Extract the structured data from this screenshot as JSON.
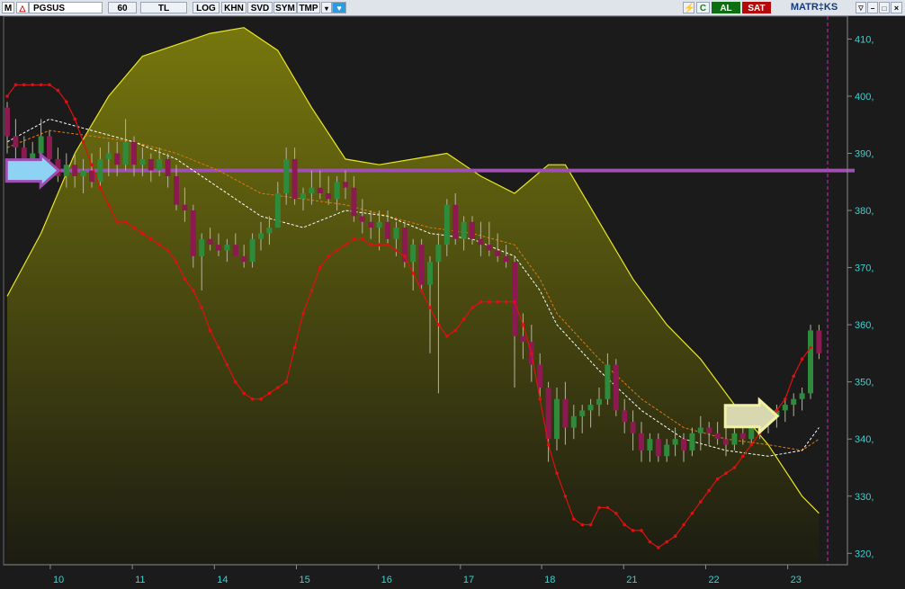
{
  "toolbar": {
    "m_label": "M",
    "logo_label": "△",
    "symbol": "PGSUS",
    "period": "60",
    "currency": "TL",
    "log": "LOG",
    "khn": "KHN",
    "svd": "SVD",
    "sym": "SYM",
    "tmp": "TMP",
    "dropdown": "▾",
    "twitter": "♥",
    "bolt": "⚡",
    "refresh": "C",
    "buy": "AL",
    "sell": "SAT",
    "brand": "MATR‡KS",
    "win_down": "▽",
    "win_min": "−",
    "win_max": "□",
    "win_close": "×"
  },
  "colors": {
    "background": "#1b1b1b",
    "band_fill": "#6c6c0c",
    "band_line": "#e8e820",
    "price_up": "#2e8b3c",
    "price_down": "#8b1a50",
    "ma_orange": "#e07a12",
    "ma_white": "#ffffff",
    "red_line": "#e01010",
    "horizontal_line": "#a050b0",
    "axis_text": "#33d6d6"
  },
  "icons": [
    "twitter-icon",
    "bolt-icon",
    "arrow-right-icon"
  ],
  "chart_data": {
    "type": "candlestick",
    "y_axis": {
      "min": 318,
      "max": 414,
      "ticks": [
        410,
        400,
        390,
        380,
        370,
        360,
        350,
        340,
        330,
        320
      ],
      "tick_suffix": ","
    },
    "x_ticks": [
      {
        "label": "10",
        "i": 5.1
      },
      {
        "label": "11",
        "i": 14.8
      },
      {
        "label": "14",
        "i": 24.5
      },
      {
        "label": "15",
        "i": 34.2
      },
      {
        "label": "16",
        "i": 43.9
      },
      {
        "label": "17",
        "i": 53.6
      },
      {
        "label": "18",
        "i": 63.2
      },
      {
        "label": "21",
        "i": 72.9
      },
      {
        "label": "22",
        "i": 82.6
      },
      {
        "label": "23",
        "i": 92.3
      }
    ],
    "candles": [
      [
        398,
        399,
        390,
        393
      ],
      [
        393,
        396,
        388,
        391
      ],
      [
        391,
        393,
        386,
        388
      ],
      [
        388,
        392,
        386,
        390
      ],
      [
        390,
        396,
        389,
        393
      ],
      [
        393,
        394,
        387,
        389
      ],
      [
        389,
        391,
        385,
        386
      ],
      [
        386,
        390,
        384,
        388
      ],
      [
        388,
        390,
        384,
        386
      ],
      [
        386,
        389,
        383,
        387
      ],
      [
        387,
        390,
        384,
        385
      ],
      [
        385,
        391,
        384,
        389
      ],
      [
        389,
        392,
        386,
        390
      ],
      [
        390,
        392,
        386,
        388
      ],
      [
        388,
        396,
        387,
        392
      ],
      [
        392,
        393,
        386,
        388
      ],
      [
        388,
        391,
        386,
        389
      ],
      [
        389,
        390,
        385,
        387
      ],
      [
        387,
        391,
        386,
        389
      ],
      [
        389,
        390,
        384,
        386
      ],
      [
        386,
        388,
        380,
        381
      ],
      [
        381,
        384,
        378,
        380
      ],
      [
        380,
        381,
        370,
        372
      ],
      [
        372,
        376,
        366,
        375
      ],
      [
        375,
        377,
        373,
        374
      ],
      [
        374,
        376,
        372,
        373
      ],
      [
        373,
        375,
        371,
        374
      ],
      [
        374,
        376,
        372,
        372
      ],
      [
        372,
        374,
        370,
        371
      ],
      [
        371,
        376,
        370,
        375
      ],
      [
        375,
        378,
        373,
        376
      ],
      [
        376,
        379,
        374,
        377
      ],
      [
        377,
        385,
        377,
        383
      ],
      [
        383,
        391,
        381,
        389
      ],
      [
        389,
        391,
        381,
        382
      ],
      [
        382,
        384,
        380,
        383
      ],
      [
        383,
        387,
        381,
        384
      ],
      [
        384,
        387,
        382,
        383
      ],
      [
        383,
        386,
        381,
        382
      ],
      [
        382,
        386,
        380,
        385
      ],
      [
        385,
        387,
        382,
        384
      ],
      [
        384,
        386,
        378,
        379
      ],
      [
        379,
        382,
        376,
        378
      ],
      [
        378,
        380,
        375,
        377
      ],
      [
        377,
        380,
        373,
        378
      ],
      [
        378,
        380,
        374,
        375
      ],
      [
        375,
        378,
        372,
        377
      ],
      [
        377,
        378,
        370,
        371
      ],
      [
        371,
        375,
        366,
        374
      ],
      [
        374,
        375,
        366,
        367
      ],
      [
        367,
        372,
        355,
        371
      ],
      [
        371,
        376,
        348,
        374
      ],
      [
        374,
        382,
        372,
        381
      ],
      [
        381,
        383,
        374,
        375
      ],
      [
        375,
        379,
        373,
        378
      ],
      [
        378,
        379,
        374,
        375
      ],
      [
        375,
        378,
        372,
        374
      ],
      [
        374,
        378,
        372,
        373
      ],
      [
        373,
        376,
        371,
        372
      ],
      [
        372,
        374,
        370,
        371
      ],
      [
        371,
        372,
        349,
        358
      ],
      [
        358,
        362,
        354,
        357
      ],
      [
        357,
        360,
        350,
        353
      ],
      [
        353,
        355,
        347,
        349
      ],
      [
        349,
        350,
        336,
        340
      ],
      [
        340,
        349,
        338,
        347
      ],
      [
        347,
        350,
        339,
        342
      ],
      [
        342,
        346,
        340,
        344
      ],
      [
        344,
        346,
        341,
        345
      ],
      [
        345,
        347,
        342,
        346
      ],
      [
        346,
        349,
        344,
        347
      ],
      [
        347,
        355,
        346,
        353
      ],
      [
        353,
        354,
        344,
        345
      ],
      [
        345,
        347,
        341,
        343
      ],
      [
        343,
        345,
        338,
        341
      ],
      [
        341,
        343,
        336,
        338
      ],
      [
        338,
        341,
        336,
        340
      ],
      [
        340,
        341,
        336,
        337
      ],
      [
        337,
        340,
        336,
        339
      ],
      [
        339,
        342,
        337,
        340
      ],
      [
        340,
        341,
        336,
        338
      ],
      [
        338,
        342,
        337,
        341
      ],
      [
        341,
        344,
        338,
        342
      ],
      [
        342,
        343,
        339,
        341
      ],
      [
        341,
        343,
        339,
        340
      ],
      [
        340,
        342,
        337,
        339
      ],
      [
        339,
        342,
        338,
        341
      ],
      [
        341,
        343,
        339,
        340
      ],
      [
        340,
        343,
        339,
        342
      ],
      [
        342,
        344,
        340,
        343
      ],
      [
        343,
        345,
        341,
        344
      ],
      [
        344,
        346,
        342,
        345
      ],
      [
        345,
        347,
        343,
        346
      ],
      [
        346,
        348,
        344,
        347
      ],
      [
        347,
        349,
        345,
        348
      ],
      [
        348,
        360,
        347,
        359
      ],
      [
        359,
        360,
        354,
        355
      ]
    ],
    "volume_band_upper": [
      [
        0,
        365
      ],
      [
        4,
        376
      ],
      [
        8,
        390
      ],
      [
        12,
        400
      ],
      [
        16,
        407
      ],
      [
        20,
        409
      ],
      [
        24,
        411
      ],
      [
        28,
        412
      ],
      [
        32,
        408
      ],
      [
        36,
        398
      ],
      [
        40,
        389
      ],
      [
        44,
        388
      ],
      [
        48,
        389
      ],
      [
        52,
        390
      ],
      [
        56,
        386
      ],
      [
        60,
        383
      ],
      [
        64,
        388
      ],
      [
        66,
        388
      ],
      [
        70,
        378
      ],
      [
        74,
        368
      ],
      [
        78,
        360
      ],
      [
        82,
        354
      ],
      [
        86,
        346
      ],
      [
        90,
        339
      ],
      [
        94,
        330
      ],
      [
        96,
        327
      ]
    ],
    "ma_orange": [
      [
        0,
        391
      ],
      [
        5,
        394
      ],
      [
        10,
        393
      ],
      [
        15,
        392
      ],
      [
        20,
        390
      ],
      [
        25,
        387
      ],
      [
        30,
        383
      ],
      [
        35,
        382
      ],
      [
        40,
        381
      ],
      [
        45,
        379
      ],
      [
        50,
        377
      ],
      [
        55,
        376
      ],
      [
        60,
        374
      ],
      [
        63,
        368
      ],
      [
        65,
        362
      ],
      [
        70,
        354
      ],
      [
        75,
        347
      ],
      [
        80,
        342
      ],
      [
        85,
        340
      ],
      [
        90,
        339
      ],
      [
        94,
        338
      ],
      [
        96,
        340
      ]
    ],
    "ma_white": [
      [
        0,
        392
      ],
      [
        5,
        396
      ],
      [
        10,
        394
      ],
      [
        15,
        392
      ],
      [
        20,
        389
      ],
      [
        25,
        384
      ],
      [
        30,
        379
      ],
      [
        35,
        377
      ],
      [
        40,
        380
      ],
      [
        45,
        379
      ],
      [
        50,
        376
      ],
      [
        55,
        375
      ],
      [
        60,
        372
      ],
      [
        63,
        366
      ],
      [
        65,
        360
      ],
      [
        70,
        352
      ],
      [
        75,
        345
      ],
      [
        80,
        340
      ],
      [
        85,
        338
      ],
      [
        90,
        337
      ],
      [
        94,
        338
      ],
      [
        96,
        342
      ]
    ],
    "red_line": [
      [
        0,
        400
      ],
      [
        1,
        402
      ],
      [
        2,
        402
      ],
      [
        3,
        402
      ],
      [
        4,
        402
      ],
      [
        5,
        402
      ],
      [
        6,
        401
      ],
      [
        7,
        399
      ],
      [
        8,
        396
      ],
      [
        9,
        392
      ],
      [
        10,
        388
      ],
      [
        11,
        384
      ],
      [
        12,
        381
      ],
      [
        13,
        378
      ],
      [
        14,
        378
      ],
      [
        15,
        377
      ],
      [
        16,
        376
      ],
      [
        17,
        375
      ],
      [
        18,
        374
      ],
      [
        19,
        373
      ],
      [
        20,
        371
      ],
      [
        21,
        368
      ],
      [
        22,
        366
      ],
      [
        23,
        363
      ],
      [
        24,
        359
      ],
      [
        25,
        356
      ],
      [
        26,
        353
      ],
      [
        27,
        350
      ],
      [
        28,
        348
      ],
      [
        29,
        347
      ],
      [
        30,
        347
      ],
      [
        31,
        348
      ],
      [
        32,
        349
      ],
      [
        33,
        350
      ],
      [
        34,
        356
      ],
      [
        35,
        362
      ],
      [
        36,
        366
      ],
      [
        37,
        370
      ],
      [
        38,
        372
      ],
      [
        39,
        373
      ],
      [
        40,
        374
      ],
      [
        41,
        375
      ],
      [
        42,
        375
      ],
      [
        43,
        374
      ],
      [
        44,
        374
      ],
      [
        45,
        374
      ],
      [
        46,
        373
      ],
      [
        47,
        372
      ],
      [
        48,
        369
      ],
      [
        49,
        366
      ],
      [
        50,
        363
      ],
      [
        51,
        360
      ],
      [
        52,
        358
      ],
      [
        53,
        359
      ],
      [
        54,
        361
      ],
      [
        55,
        363
      ],
      [
        56,
        364
      ],
      [
        57,
        364
      ],
      [
        58,
        364
      ],
      [
        59,
        364
      ],
      [
        60,
        364
      ],
      [
        61,
        360
      ],
      [
        62,
        355
      ],
      [
        63,
        347
      ],
      [
        64,
        339
      ],
      [
        65,
        334
      ],
      [
        66,
        330
      ],
      [
        67,
        326
      ],
      [
        68,
        325
      ],
      [
        69,
        325
      ],
      [
        70,
        328
      ],
      [
        71,
        328
      ],
      [
        72,
        327
      ],
      [
        73,
        325
      ],
      [
        74,
        324
      ],
      [
        75,
        324
      ],
      [
        76,
        322
      ],
      [
        77,
        321
      ],
      [
        78,
        322
      ],
      [
        79,
        323
      ],
      [
        80,
        325
      ],
      [
        81,
        327
      ],
      [
        82,
        329
      ],
      [
        83,
        331
      ],
      [
        84,
        333
      ],
      [
        85,
        334
      ],
      [
        86,
        335
      ],
      [
        87,
        337
      ],
      [
        88,
        339
      ],
      [
        89,
        341
      ],
      [
        90,
        343
      ],
      [
        91,
        345
      ],
      [
        92,
        347
      ],
      [
        93,
        351
      ],
      [
        94,
        354
      ],
      [
        95,
        356
      ]
    ],
    "horizontal_line": 387,
    "markers": [
      {
        "type": "arrow",
        "direction": "right",
        "color": "#8fd3f4",
        "i": 3,
        "y": 387
      },
      {
        "type": "arrow",
        "direction": "right",
        "color": "#d8d8b0",
        "i": 88,
        "y": 344
      }
    ]
  }
}
